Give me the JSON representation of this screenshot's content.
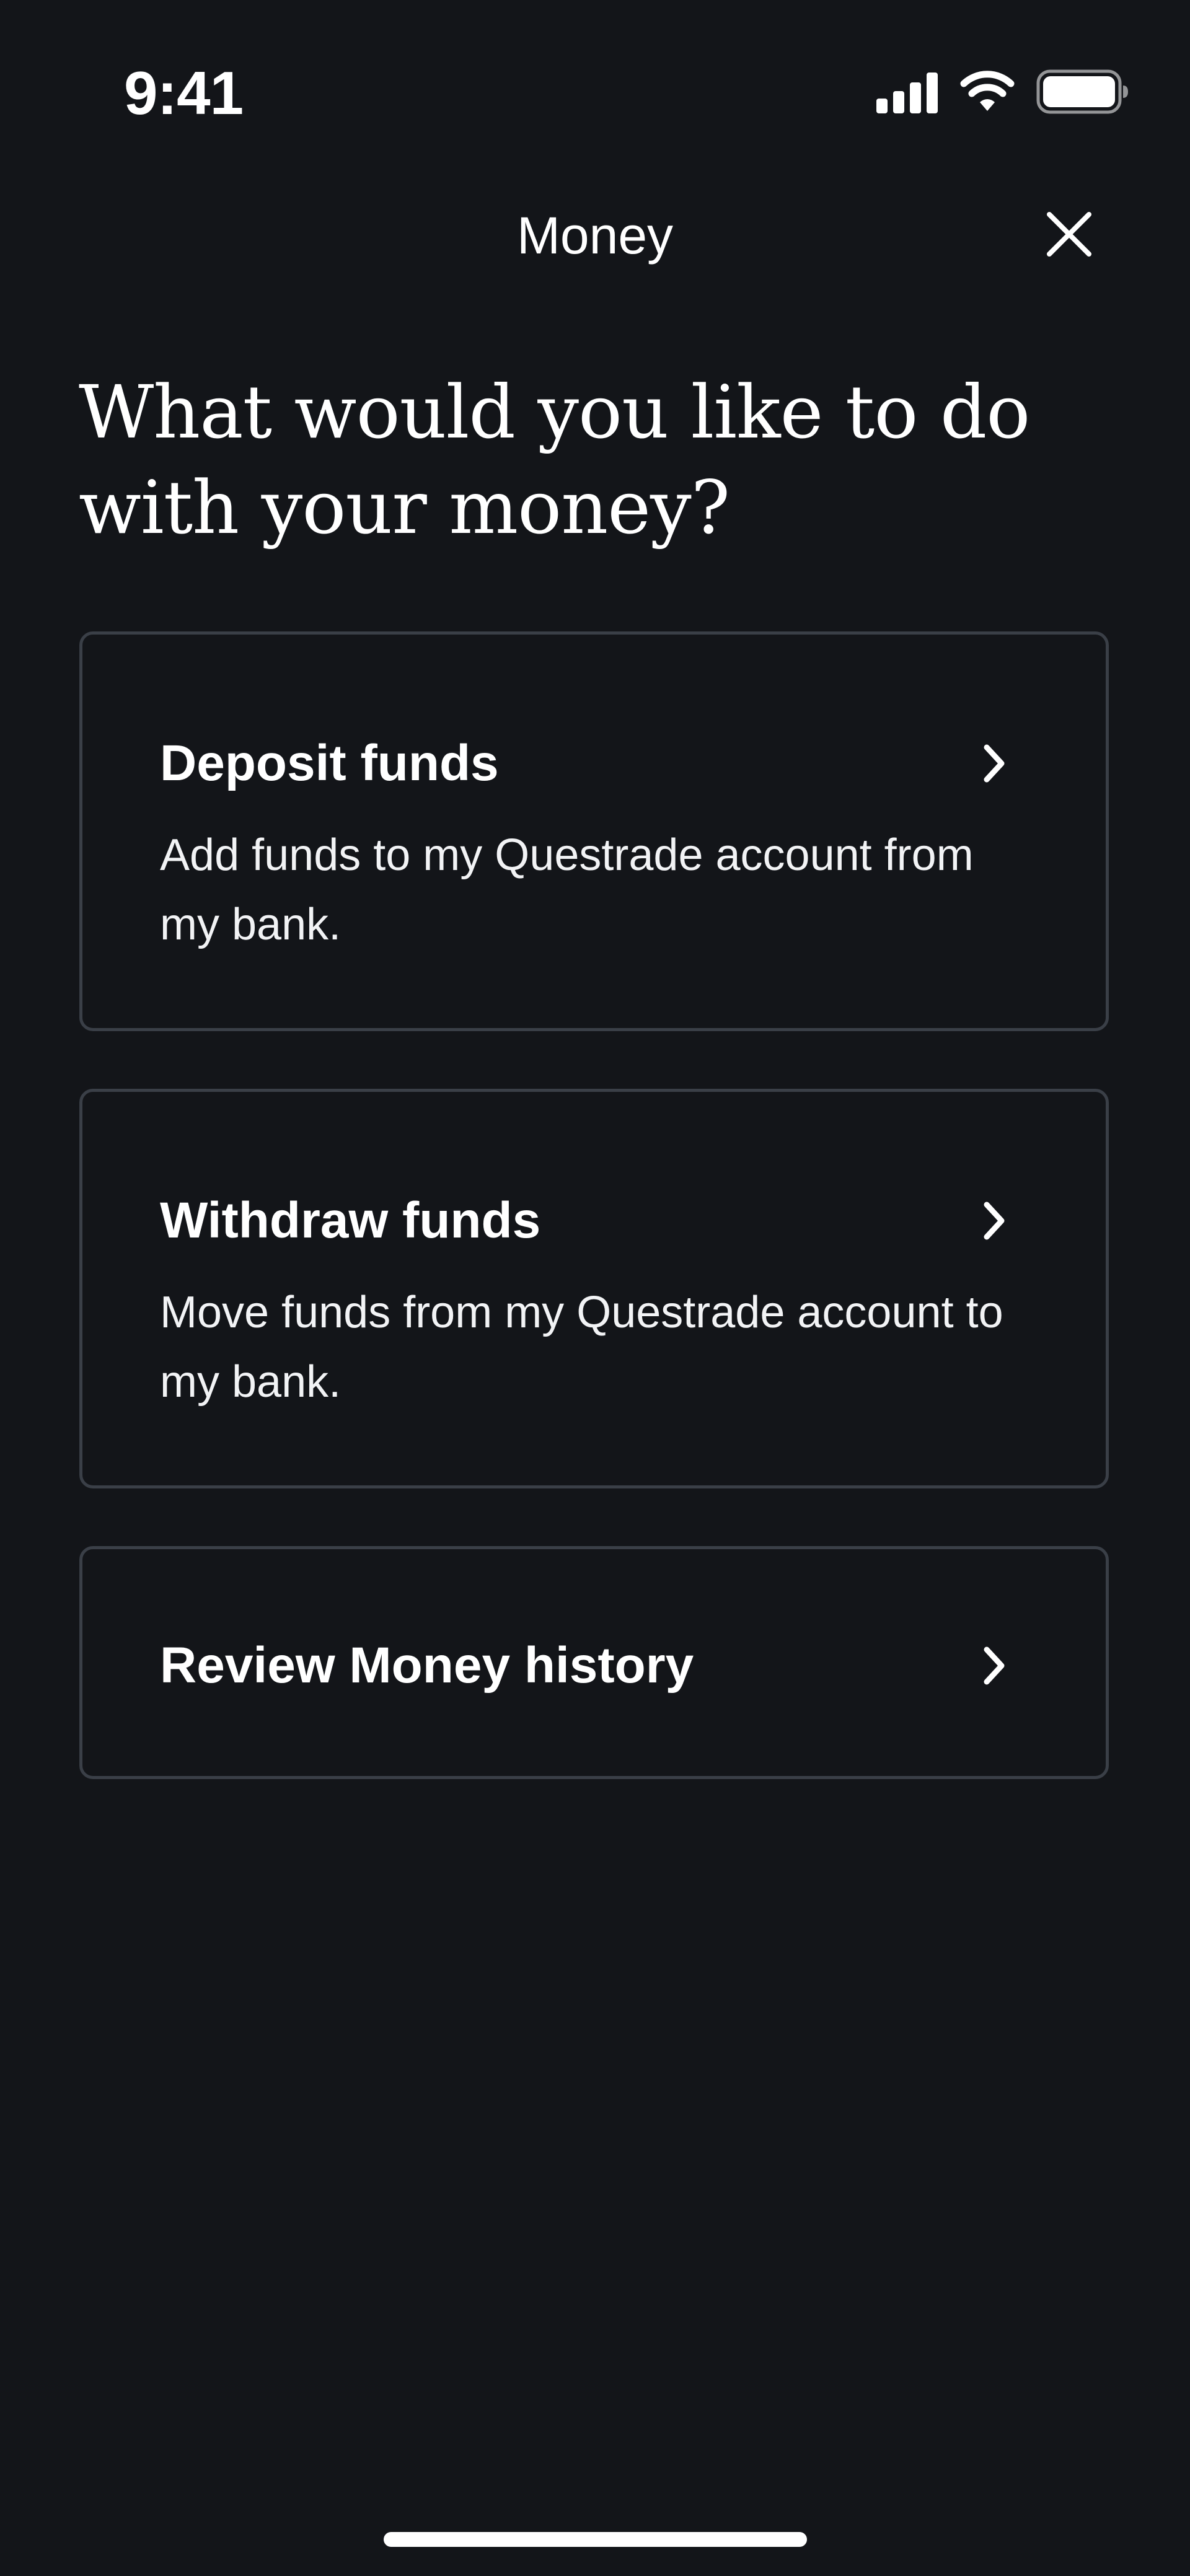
{
  "status_bar": {
    "time": "9:41"
  },
  "header": {
    "title": "Money",
    "close_icon": "close-icon"
  },
  "headline": "What would you like to do with your money?",
  "options": [
    {
      "title": "Deposit funds",
      "description": "Add funds to my Questrade account from my bank.",
      "icon": "chevron-right-icon"
    },
    {
      "title": "Withdraw funds",
      "description": "Move funds from my Questrade account to my bank.",
      "icon": "chevron-right-icon"
    },
    {
      "title": "Review Money history",
      "icon": "chevron-right-icon"
    }
  ],
  "colors": {
    "background": "#131519",
    "card_border": "#3a3f47",
    "text": "#ffffff"
  }
}
